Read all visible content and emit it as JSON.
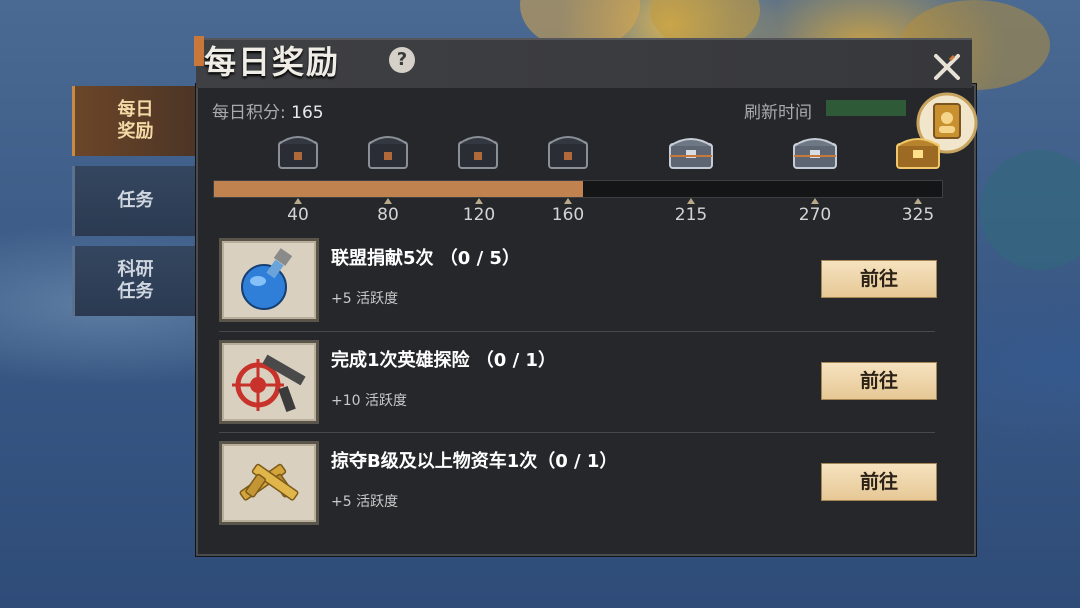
{
  "panel": {
    "title": "每日奖励",
    "help_glyph": "?",
    "icons": {
      "help": "question-icon",
      "close": "close-icon"
    }
  },
  "side_tabs": [
    {
      "line1": "每日",
      "line2": "奖励",
      "active": true
    },
    {
      "line1": "任务",
      "line2": "",
      "active": false
    },
    {
      "line1": "科研",
      "line2": "任务",
      "active": false
    }
  ],
  "score": {
    "label": "每日积分: ",
    "value": "165"
  },
  "refresh": {
    "label": "刷新时间"
  },
  "progress": {
    "current": 165,
    "max": 325,
    "fill_fraction": 0.507
  },
  "milestones": [
    {
      "value": "40",
      "chest": "chest-dark"
    },
    {
      "value": "80",
      "chest": "chest-dark"
    },
    {
      "value": "120",
      "chest": "chest-dark"
    },
    {
      "value": "160",
      "chest": "chest-dark"
    },
    {
      "value": "215",
      "chest": "chest-silver"
    },
    {
      "value": "270",
      "chest": "chest-silver"
    },
    {
      "value": "325",
      "chest": "chest-gold"
    }
  ],
  "tasks": [
    {
      "title": "联盟捐献5次 （0 / 5）",
      "reward": "+5 活跃度",
      "button": "前往",
      "icon": "potion-flask-icon"
    },
    {
      "title": "完成1次英雄探险 （0 / 1）",
      "reward": "+10 活跃度",
      "button": "前往",
      "icon": "gun-target-icon"
    },
    {
      "title": "掠夺B级及以上物资车1次（0 / 1）",
      "reward": "+5 活跃度",
      "button": "前往",
      "icon": "golden-pistols-icon"
    }
  ],
  "colors": {
    "accent": "#c0834f",
    "panel": "#26272a",
    "button": "#f0d7ab"
  }
}
